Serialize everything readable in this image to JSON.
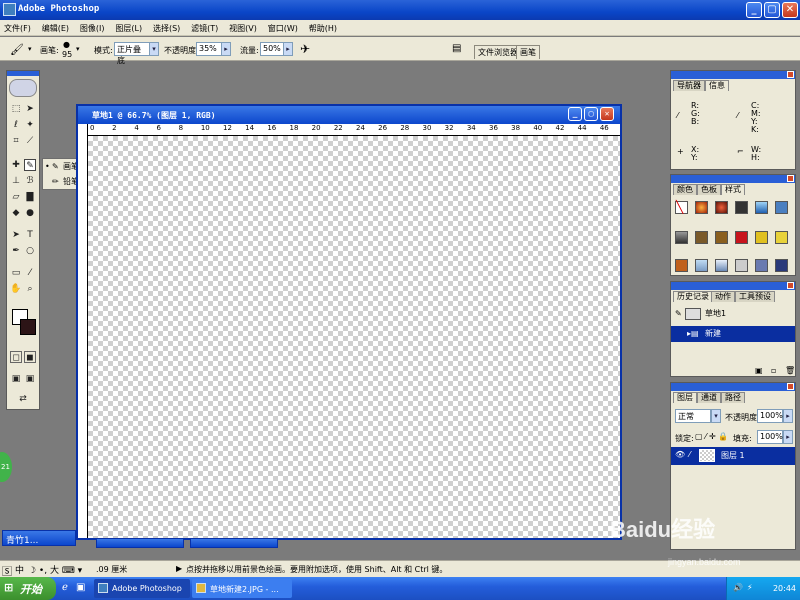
{
  "app": {
    "title": "Adobe Photoshop"
  },
  "menu": [
    "文件(F)",
    "编辑(E)",
    "图像(I)",
    "图层(L)",
    "选择(S)",
    "滤镜(T)",
    "视图(V)",
    "窗口(W)",
    "帮助(H)"
  ],
  "options": {
    "brush_label": "画笔:",
    "brush_size": "95",
    "mode_label": "模式:",
    "mode_value": "正片叠底",
    "opacity_label": "不透明度:",
    "opacity_value": "35%",
    "flow_label": "流量:",
    "flow_value": "50%",
    "well_tabs": [
      "文件浏览器",
      "画笔"
    ]
  },
  "flyout": [
    {
      "label": "画笔工具",
      "key": "B"
    },
    {
      "label": "铅笔工具",
      "key": "B"
    }
  ],
  "document": {
    "title": "草地1 @ 66.7% (图层 1, RGB)",
    "ruler_ticks": [
      "0",
      "2",
      "4",
      "6",
      "8",
      "10",
      "12",
      "14",
      "16",
      "18",
      "20",
      "22",
      "24",
      "26",
      "28",
      "30",
      "32",
      "34",
      "36",
      "38",
      "40",
      "42",
      "44",
      "46"
    ]
  },
  "navigator": {
    "tabs": [
      "导航器",
      "信息"
    ],
    "rgb": [
      "R:",
      "G:",
      "B:"
    ],
    "cmyk": [
      "C:",
      "M:",
      "Y:",
      "K:"
    ],
    "xy": [
      "X:",
      "Y:"
    ],
    "wh": [
      "W:",
      "H:"
    ]
  },
  "swatches": {
    "tabs": [
      "颜色",
      "色板",
      "样式"
    ]
  },
  "history": {
    "tabs": [
      "历史记录",
      "动作",
      "工具预设"
    ],
    "snapshot": "草地1",
    "items": [
      "新建"
    ]
  },
  "layers": {
    "tabs": [
      "图层",
      "通道",
      "路径"
    ],
    "blend": "正常",
    "opacity_label": "不透明度:",
    "opacity": "100%",
    "lock_label": "锁定:",
    "fill_label": "填充:",
    "fill": "100%",
    "layer_name": "图层 1"
  },
  "statusbar": {
    "unit": ".09 厘米",
    "hint": "点按并拖移以用前景色绘画。要用附加选项，使用 Shift、Alt 和 Ctrl 键。"
  },
  "minimized": [
    "青竹1..."
  ],
  "taskbar": {
    "start": "开始",
    "tasks": [
      "Adobe Photoshop",
      "草地新建2.JPG - ..."
    ],
    "clock": "20:44",
    "ime": "中"
  },
  "watermark": {
    "brand": "Baidu经验",
    "url": "jingyan.baidu.com"
  }
}
